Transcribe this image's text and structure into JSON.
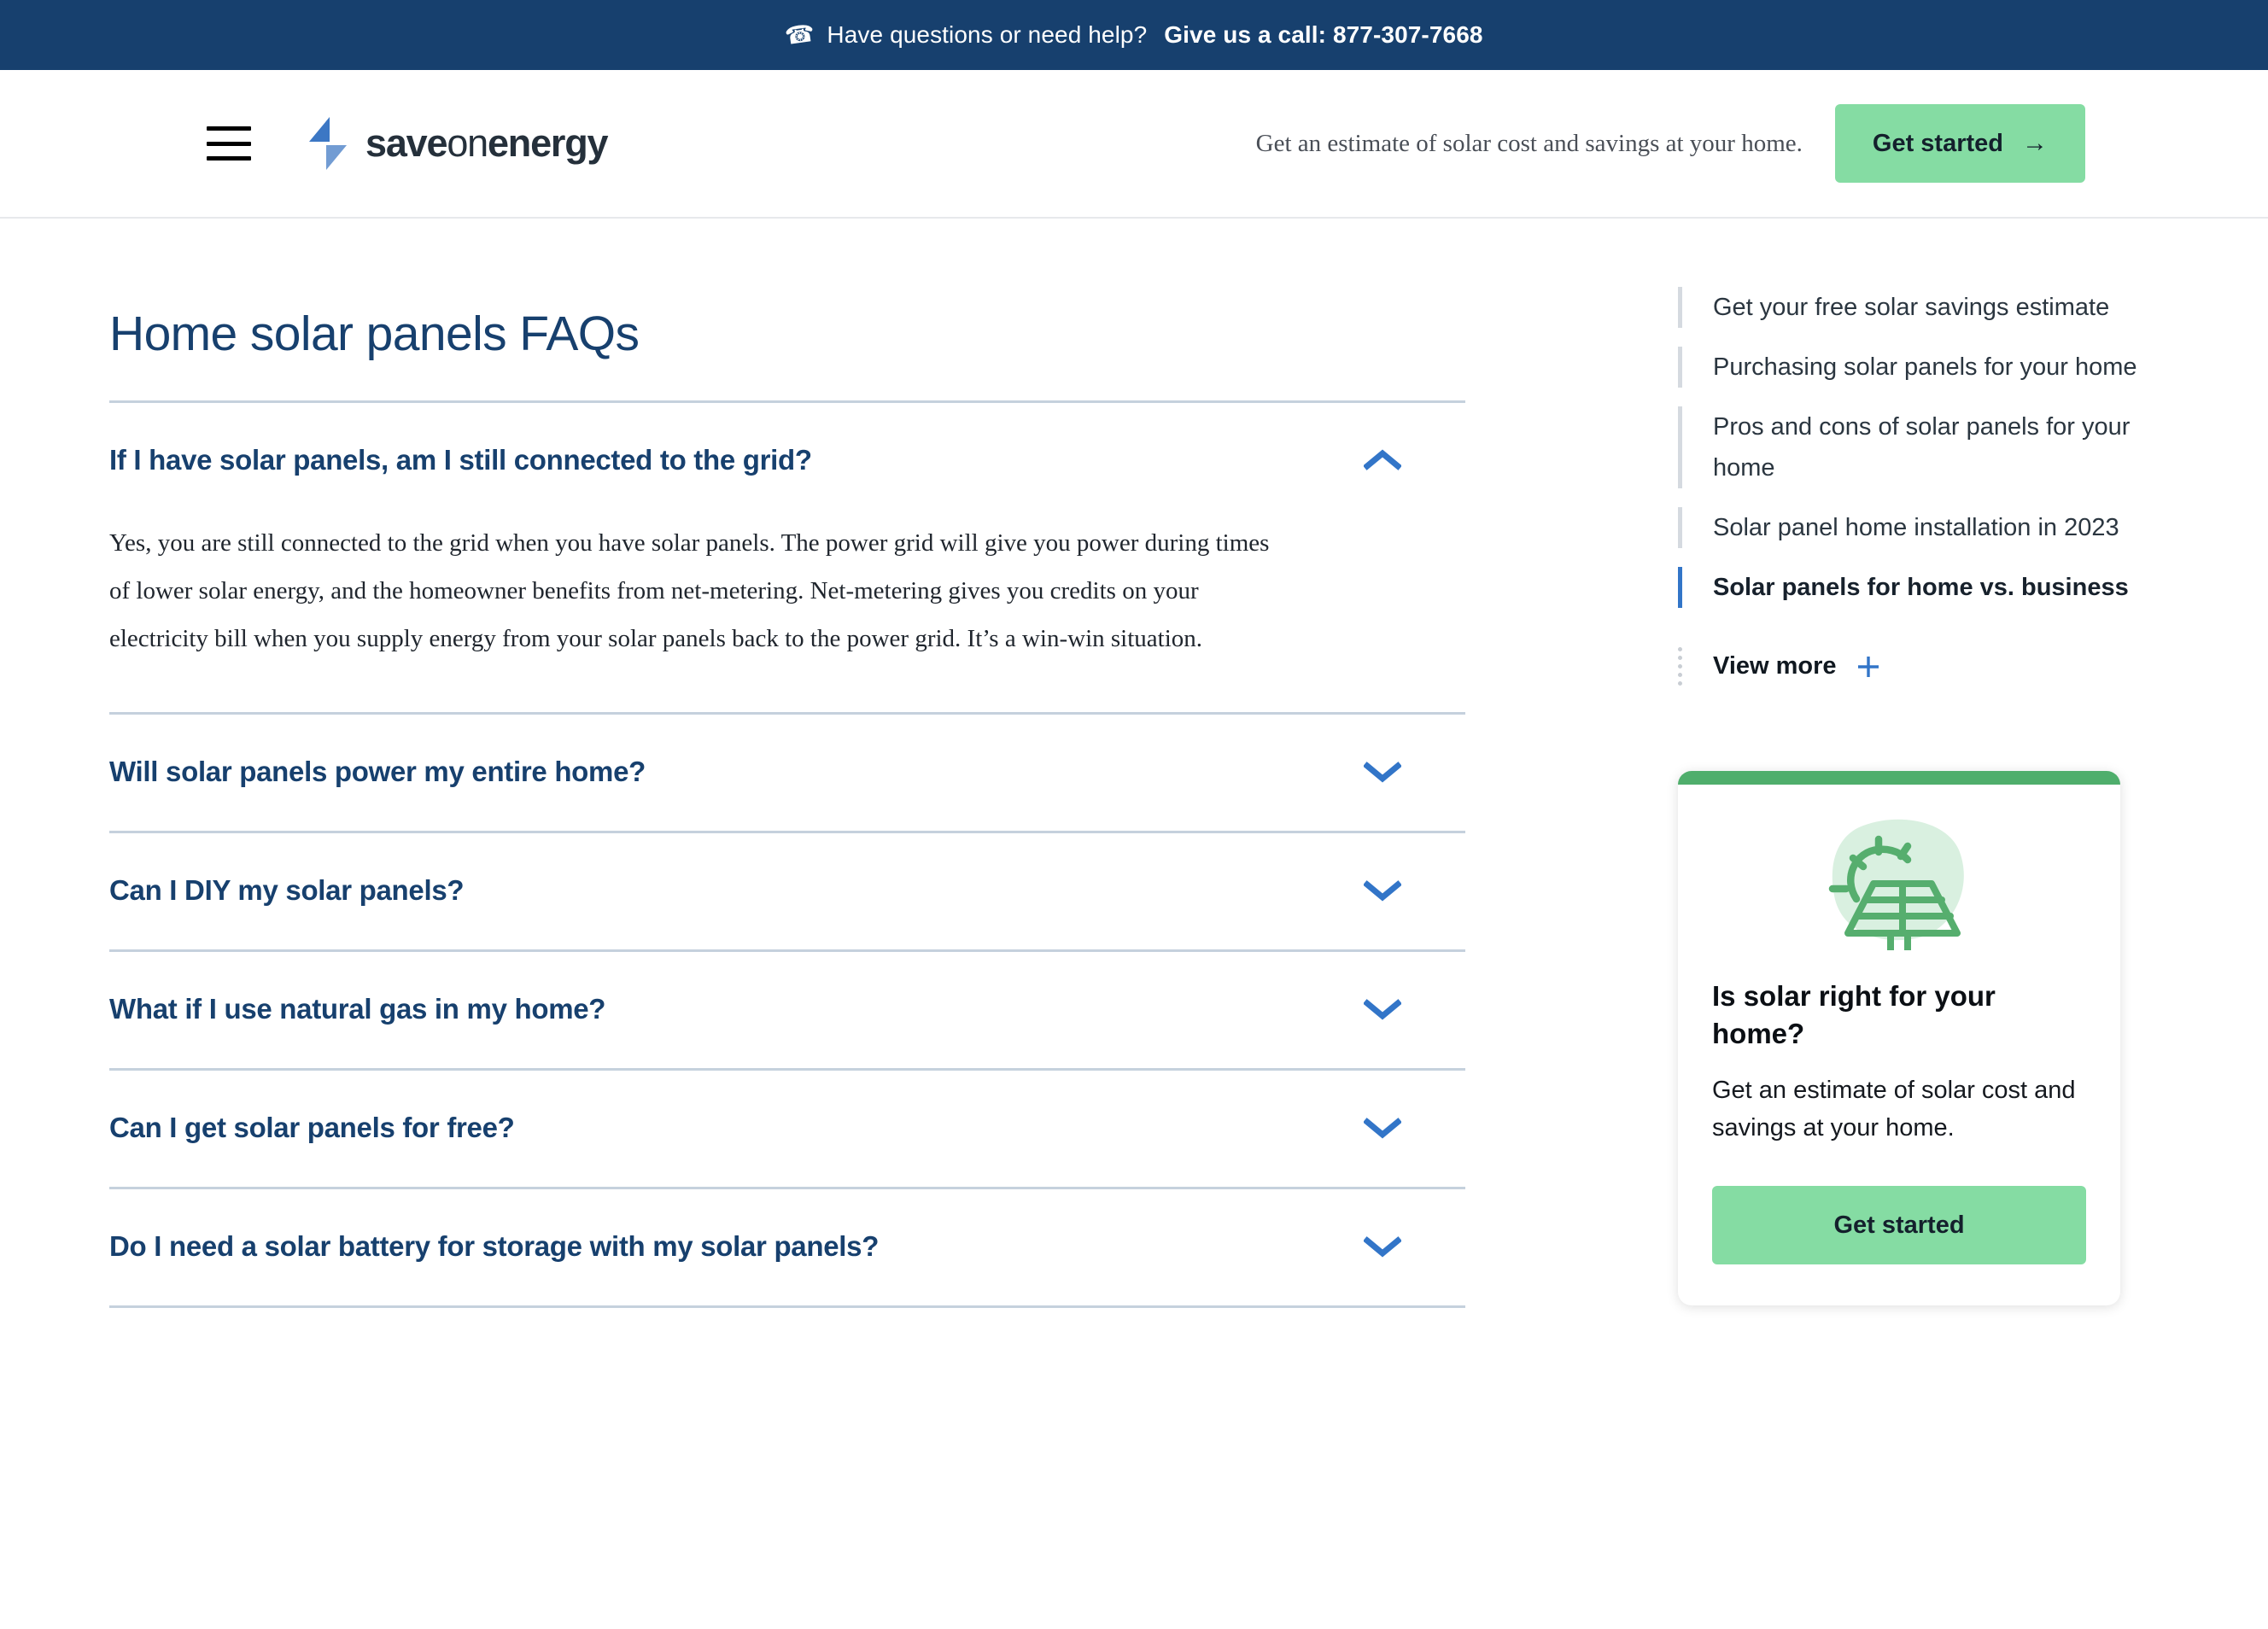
{
  "banner": {
    "phone_icon": "phone-icon",
    "text": "Have questions or need help?",
    "cta_text": "Give us a call: 877-307-7668",
    "bg_color": "#17406e"
  },
  "header": {
    "menu_icon": "hamburger-menu-icon",
    "logo_icon": "saveonenergy-bolt-logo",
    "brand_part1": "save",
    "brand_part2": "on",
    "brand_part3": "energy",
    "blurb": "Get an estimate of solar cost and savings at your home.",
    "cta_label": "Get started",
    "cta_arrow": "→",
    "cta_color": "#85dca3"
  },
  "main": {
    "page_title": "Home solar panels FAQs",
    "title_color": "#17406e",
    "faqs": [
      {
        "question": "If I have solar panels, am I still connected to the grid?",
        "expanded": true,
        "chevron": "chevron-up-icon",
        "answer": "Yes, you are still connected to the grid when you have solar panels. The power grid will give you power during times of lower solar energy, and the homeowner benefits from net-metering. Net-metering gives you credits on your electricity bill when you supply energy from your solar panels back to the power grid. It’s a win-win situation."
      },
      {
        "question": "Will solar panels power my entire home?",
        "expanded": false,
        "chevron": "chevron-down-icon",
        "answer": ""
      },
      {
        "question": "Can I DIY my solar panels?",
        "expanded": false,
        "chevron": "chevron-down-icon",
        "answer": ""
      },
      {
        "question": "What if I use natural gas in my home?",
        "expanded": false,
        "chevron": "chevron-down-icon",
        "answer": ""
      },
      {
        "question": "Can I get solar panels for free?",
        "expanded": false,
        "chevron": "chevron-down-icon",
        "answer": ""
      },
      {
        "question": "Do I need a solar battery for storage with my solar panels?",
        "expanded": false,
        "chevron": "chevron-down-icon",
        "answer": ""
      }
    ]
  },
  "sidebar": {
    "items": [
      {
        "label": "Get your free solar savings estimate",
        "active": false
      },
      {
        "label": "Purchasing solar panels for your home",
        "active": false
      },
      {
        "label": "Pros and cons of solar panels for your home",
        "active": false
      },
      {
        "label": "Solar panel home installation in 2023",
        "active": false
      },
      {
        "label": "Solar panels for home vs. business",
        "active": true
      }
    ],
    "view_more_label": "View more",
    "view_more_icon": "plus-icon",
    "active_color": "#3275c8"
  },
  "promo": {
    "icon": "solar-panel-sun-icon",
    "accent_color": "#4fae6c",
    "title": "Is solar right for your home?",
    "text": "Get an estimate of solar cost and savings at your home.",
    "button_label": "Get started",
    "button_color": "#85dca3"
  }
}
